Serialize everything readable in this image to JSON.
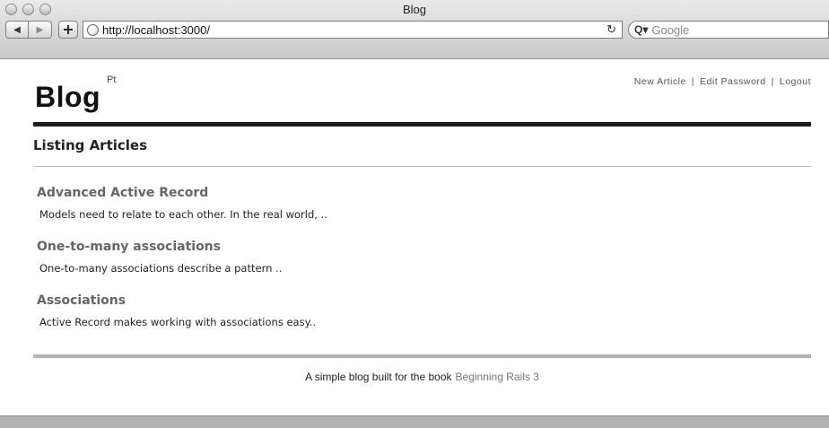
{
  "browser": {
    "window_title": "Blog",
    "url": "http://localhost:3000/",
    "search_placeholder": "Google",
    "back_glyph": "◀",
    "forward_glyph": "▶",
    "add_glyph": "+",
    "reload_glyph": "↻",
    "search_glyph": "Q▾"
  },
  "header": {
    "logo": "Blog",
    "logo_sup": "Pt",
    "nav": {
      "new_article": "New Article",
      "edit_password": "Edit Password",
      "logout": "Logout",
      "separator": "|"
    }
  },
  "main": {
    "section_title": "Listing Articles",
    "articles": [
      {
        "title": "Advanced Active Record",
        "excerpt": "Models need to relate to each other. In the real world, .."
      },
      {
        "title": "One-to-many associations",
        "excerpt": "One-to-many associations describe a pattern .."
      },
      {
        "title": "Associations",
        "excerpt": "Active Record makes working with associations easy.."
      }
    ]
  },
  "footer": {
    "text": "A simple blog built for the book",
    "link": "Beginning Rails 3"
  }
}
